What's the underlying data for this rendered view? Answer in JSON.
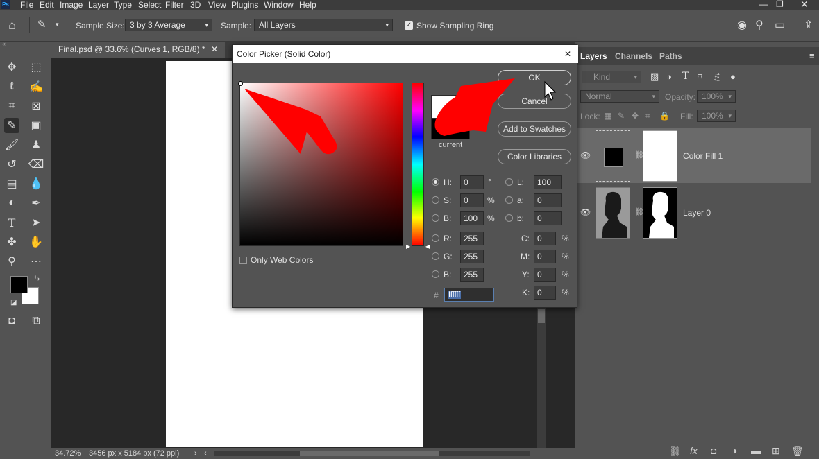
{
  "menubar": {
    "app_icon": "Ps",
    "items": [
      "File",
      "Edit",
      "Image",
      "Layer",
      "Type",
      "Select",
      "Filter",
      "3D",
      "View",
      "Plugins",
      "Window",
      "Help"
    ]
  },
  "options": {
    "sample_size_label": "Sample Size:",
    "sample_size_value": "3 by 3 Average",
    "sample_label": "Sample:",
    "sample_value": "All Layers",
    "sampling_ring_label": "Show Sampling Ring"
  },
  "document": {
    "tab_title": "Final.psd @ 33.6% (Curves 1, RGB/8) *",
    "zoom": "34.72%",
    "dimensions": "3456 px x 5184 px (72 ppi)"
  },
  "layers_panel": {
    "tabs": [
      "Layers",
      "Channels",
      "Paths"
    ],
    "filter_label": "Kind",
    "blend_mode": "Normal",
    "opacity_label": "Opacity:",
    "opacity_value": "100%",
    "lock_label": "Lock:",
    "fill_label": "Fill:",
    "fill_value": "100%",
    "layers": [
      {
        "name": "Color Fill 1"
      },
      {
        "name": "Layer 0"
      }
    ]
  },
  "dialog": {
    "title": "Color Picker (Solid Color)",
    "ok": "OK",
    "cancel": "Cancel",
    "add_to_swatches": "Add to Swatches",
    "color_libraries": "Color Libraries",
    "current_label": "current",
    "only_web_colors": "Only Web Colors",
    "hsb": {
      "h_label": "H:",
      "h": "0",
      "h_unit": "°",
      "s_label": "S:",
      "s": "0",
      "s_unit": "%",
      "b_label": "B:",
      "b": "100",
      "b_unit": "%"
    },
    "lab": {
      "l_label": "L:",
      "l": "100",
      "a_label": "a:",
      "a": "0",
      "b_label": "b:",
      "b": "0"
    },
    "rgb": {
      "r_label": "R:",
      "r": "255",
      "g_label": "G:",
      "g": "255",
      "b_label": "B:",
      "b": "255"
    },
    "cmyk": {
      "c_label": "C:",
      "c": "0",
      "c_unit": "%",
      "m_label": "M:",
      "m": "0",
      "m_unit": "%",
      "y_label": "Y:",
      "y": "0",
      "y_unit": "%",
      "k_label": "K:",
      "k": "0",
      "k_unit": "%"
    },
    "hex_label": "#",
    "hex": "ffffff",
    "new_color": "#ffffff",
    "current_color": "#000000",
    "hue_color": "#ff0000"
  },
  "colors": {
    "annotation_arrow": "#ff0000"
  }
}
